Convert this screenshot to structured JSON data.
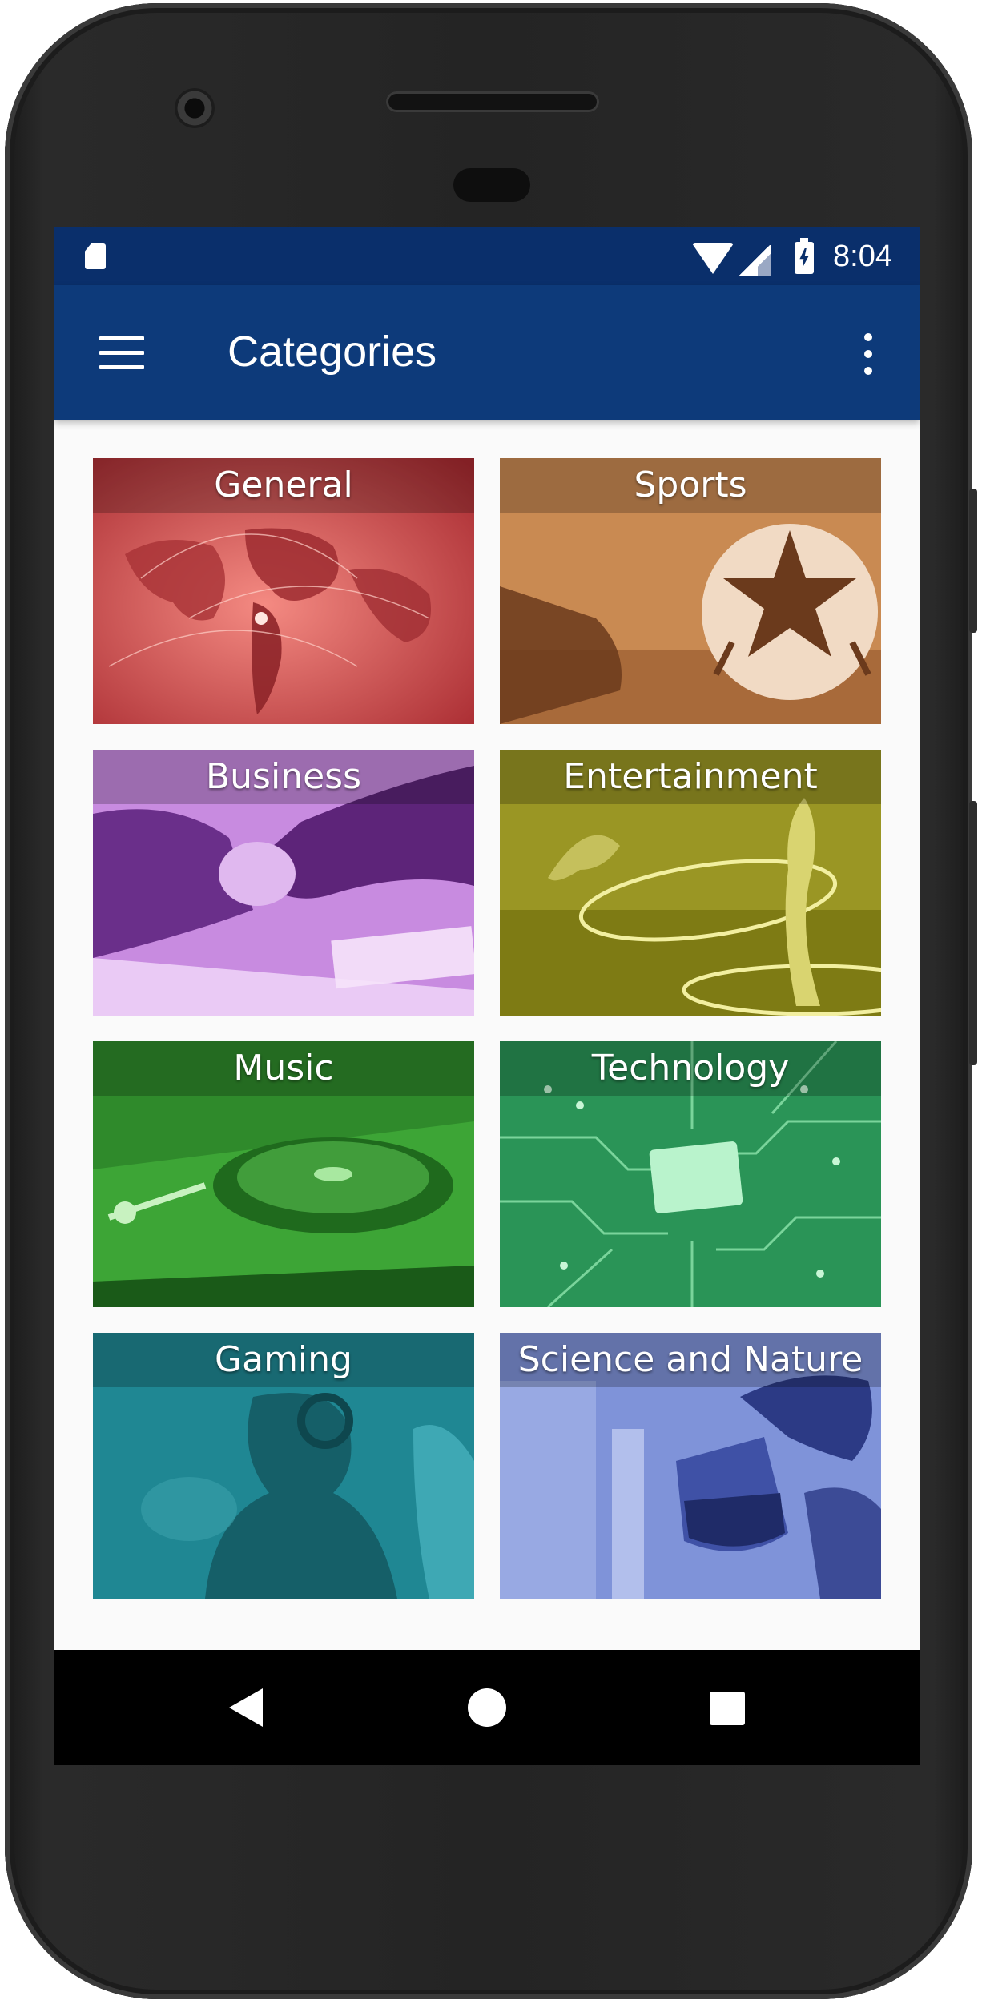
{
  "status_bar": {
    "time": "8:04",
    "icons": [
      "sd-card-icon",
      "wifi-icon",
      "cell-signal-icon",
      "battery-charging-icon"
    ]
  },
  "app_bar": {
    "title": "Categories",
    "menu_icon": "hamburger-menu-icon",
    "overflow_icon": "more-vertical-icon"
  },
  "categories": [
    {
      "label": "General",
      "color": "#c0393b"
    },
    {
      "label": "Sports",
      "color": "#b86a2c"
    },
    {
      "label": "Business",
      "color": "#a85bc4"
    },
    {
      "label": "Entertainment",
      "color": "#8f8d18"
    },
    {
      "label": "Music",
      "color": "#2e8f2a"
    },
    {
      "label": "Technology",
      "color": "#2b9a5a"
    },
    {
      "label": "Gaming",
      "color": "#1e8590"
    },
    {
      "label": "Science and Nature",
      "color": "#3a4fa8"
    }
  ],
  "nav_bar": {
    "buttons": [
      "back-icon",
      "home-icon",
      "recents-icon"
    ]
  }
}
